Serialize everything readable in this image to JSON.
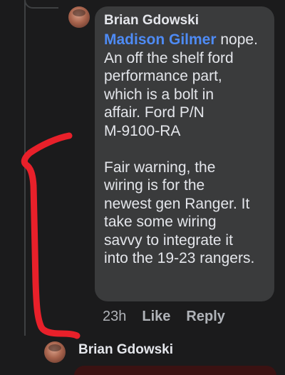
{
  "comment": {
    "author": "Brian Gdowski",
    "mention": "Madison Gilmer",
    "text_after_mention": " nope.\nAn off the shelf ford\nperformance part,\nwhich is a bolt in\naffair. Ford P/N\nM-9100-RA\n\nFair warning, the\nwiring is for the\nnewest gen Ranger. It\ntake some wiring\nsavvy to integrate it\ninto the 19-23 rangers.",
    "timestamp": "23h",
    "like_label": "Like",
    "reply_label": "Reply"
  },
  "next_comment": {
    "author": "Brian Gdowski"
  },
  "colors": {
    "background": "#1b1b1c",
    "bubble": "#3a3b3c",
    "text": "#e4e6eb",
    "secondary_text": "#b0b3b8",
    "mention": "#4e8bf5",
    "annotation": "#e8202a"
  }
}
